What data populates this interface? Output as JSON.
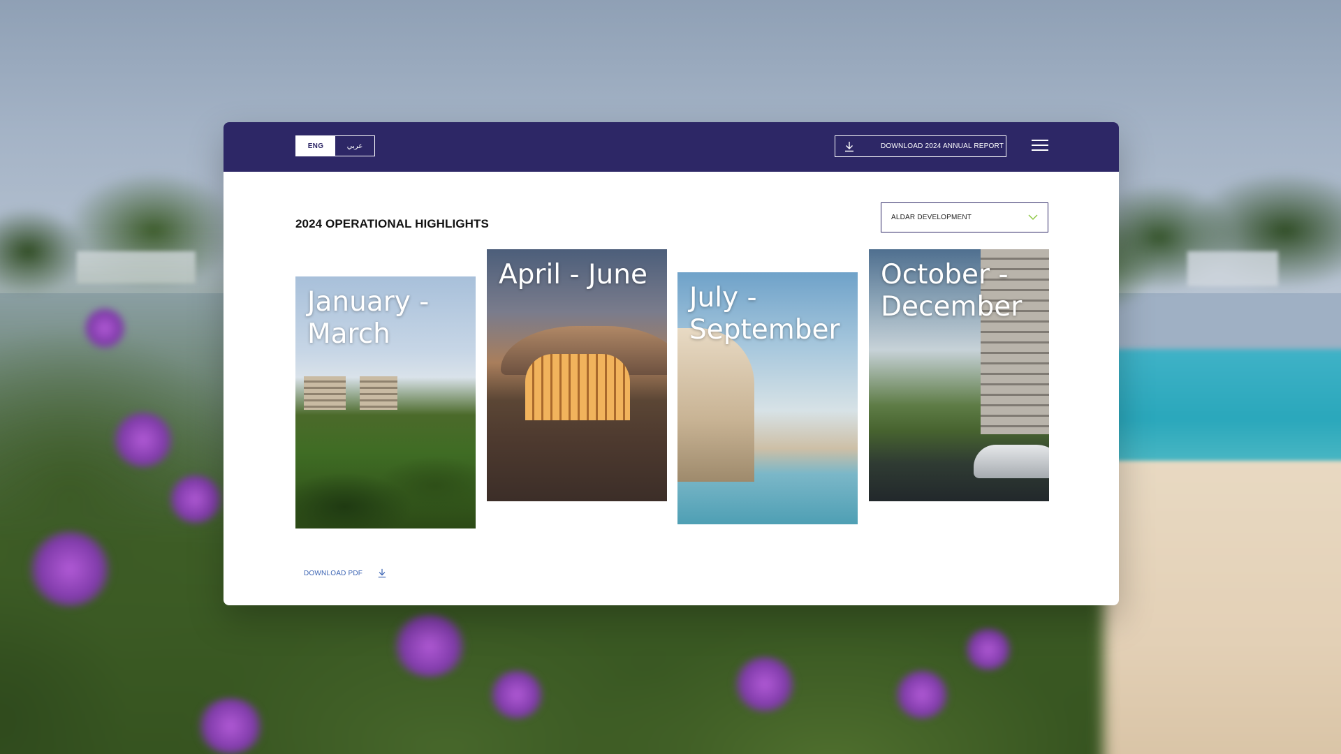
{
  "header": {
    "lang_options": [
      "ENG",
      "عربي"
    ],
    "active_lang": "ENG",
    "download_report_label": "DOWNLOAD 2024 ANNUAL REPORT"
  },
  "main": {
    "title": "2024 OPERATIONAL HIGHLIGHTS",
    "dropdown_value": "ALDAR DEVELOPMENT",
    "cards": [
      {
        "label": "January - March"
      },
      {
        "label": "April - June"
      },
      {
        "label": "July - September"
      },
      {
        "label": "October - December"
      }
    ],
    "download_pdf_label": "DOWNLOAD PDF"
  },
  "colors": {
    "topbar": "#2d2766",
    "accent_green": "#8cc63f",
    "link_blue": "#3a63b3"
  },
  "icons": [
    "download-icon",
    "menu-icon",
    "chevron-down-icon"
  ]
}
